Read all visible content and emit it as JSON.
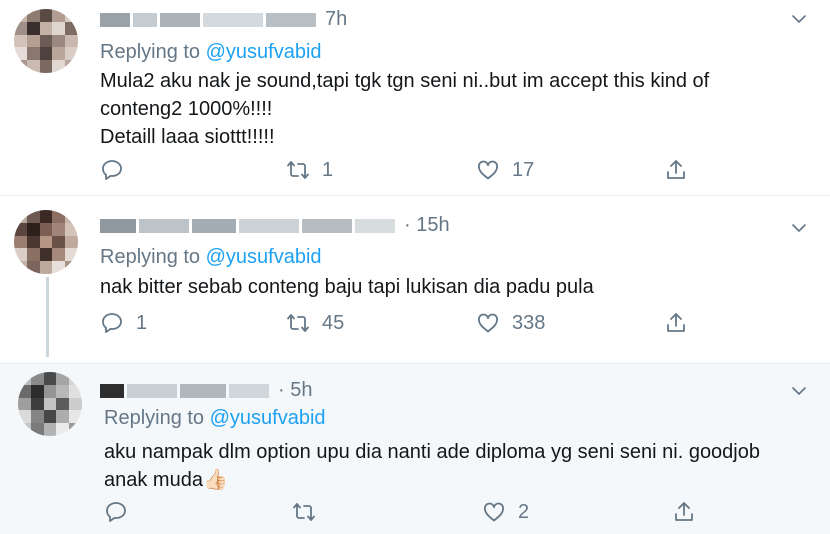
{
  "tweets": [
    {
      "time": "7h",
      "replying_prefix": "Replying to",
      "replying_handle": "@yusufvabid",
      "text_lines": [
        "Mula2 aku nak je sound,tapi tgk tgn seni ni..but im accept this kind of",
        "conteng2 1000%!!!!",
        "Detaill laaa siottt!!!!!"
      ],
      "actions": {
        "reply": "",
        "retweet": "1",
        "like": "17"
      }
    },
    {
      "time": "· 15h",
      "replying_prefix": "Replying to",
      "replying_handle": "@yusufvabid",
      "text_lines": [
        "nak bitter sebab conteng baju tapi lukisan dia padu pula"
      ],
      "actions": {
        "reply": "1",
        "retweet": "45",
        "like": "338"
      }
    },
    {
      "time": "· 5h",
      "replying_prefix": "Replying to",
      "replying_handle": "@yusufvabid",
      "text_lines": [
        "aku nampak dlm option upu dia nanti ade diploma yg seni seni ni. goodjob",
        "anak muda👍🏻"
      ],
      "actions": {
        "reply": "",
        "retweet": "",
        "like": "2"
      }
    }
  ],
  "colors": {
    "link": "#1da1f2",
    "muted": "#657786",
    "text": "#14171a",
    "highlight_bg": "#f5f8fa"
  },
  "icons": [
    "reply-icon",
    "retweet-icon",
    "like-icon",
    "share-icon",
    "chevron-down-icon"
  ]
}
